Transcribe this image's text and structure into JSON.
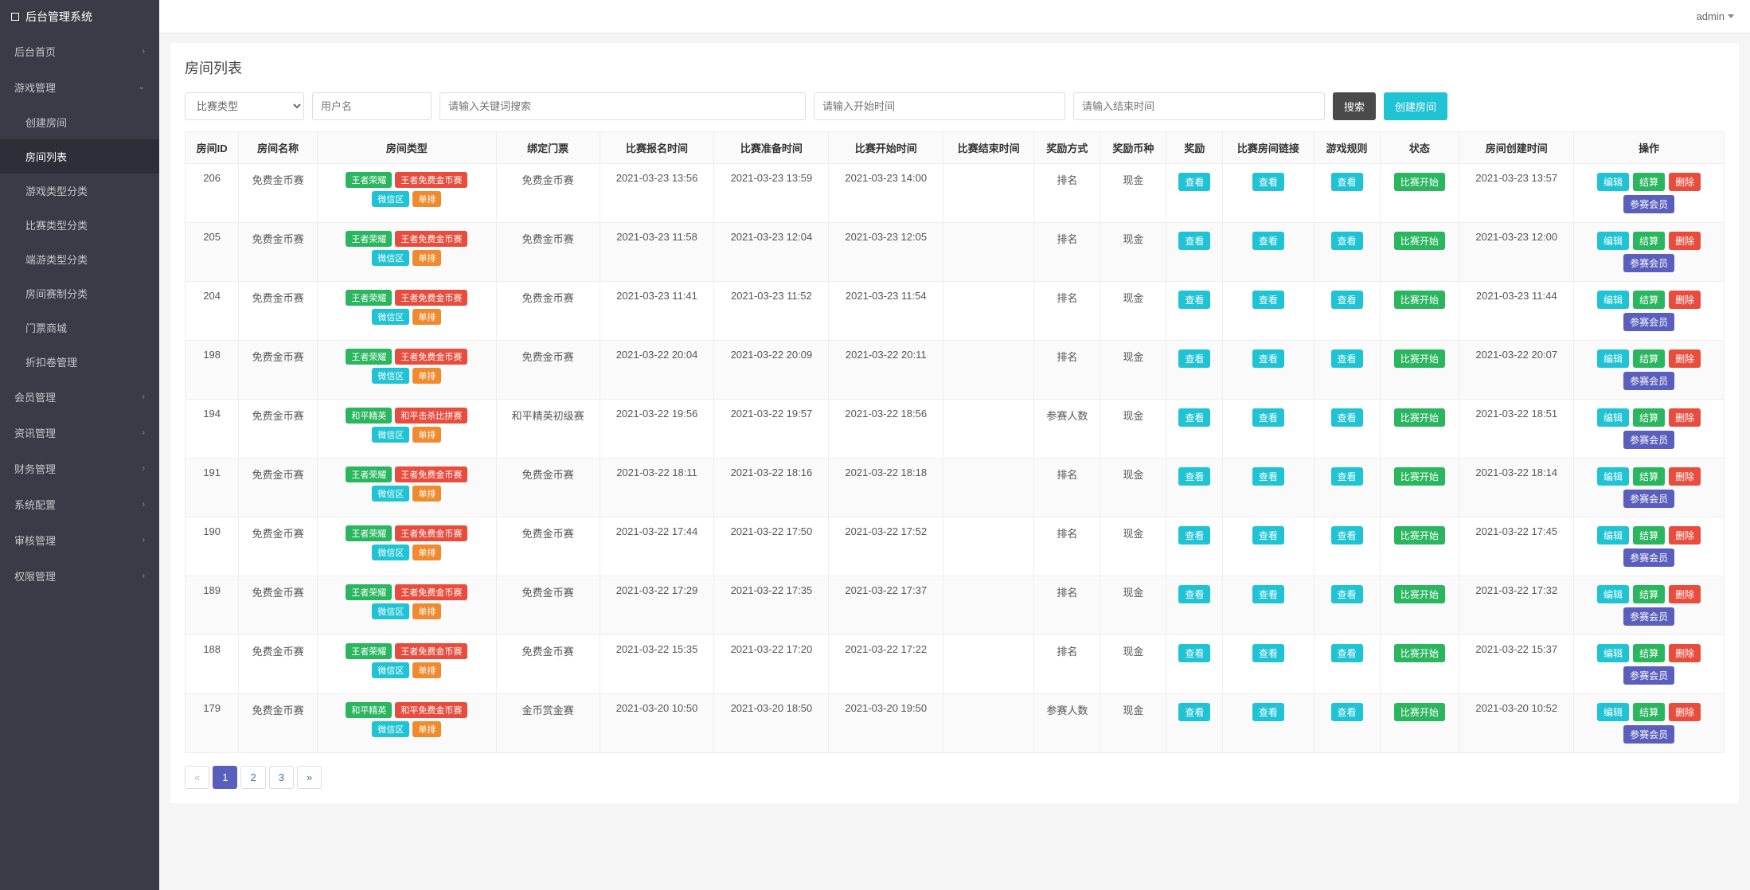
{
  "brand": "后台管理系统",
  "user": {
    "name": "admin"
  },
  "sidebar": {
    "items": [
      {
        "label": "后台首页",
        "kind": "parent"
      },
      {
        "label": "游戏管理",
        "kind": "parent-open"
      },
      {
        "label": "创建房间",
        "kind": "sub"
      },
      {
        "label": "房间列表",
        "kind": "sub-active"
      },
      {
        "label": "游戏类型分类",
        "kind": "sub"
      },
      {
        "label": "比赛类型分类",
        "kind": "sub"
      },
      {
        "label": "端游类型分类",
        "kind": "sub"
      },
      {
        "label": "房间赛制分类",
        "kind": "sub"
      },
      {
        "label": "门票商城",
        "kind": "sub"
      },
      {
        "label": "折扣卷管理",
        "kind": "sub"
      },
      {
        "label": "会员管理",
        "kind": "parent"
      },
      {
        "label": "资讯管理",
        "kind": "parent"
      },
      {
        "label": "财务管理",
        "kind": "parent"
      },
      {
        "label": "系统配置",
        "kind": "parent"
      },
      {
        "label": "审核管理",
        "kind": "parent"
      },
      {
        "label": "权限管理",
        "kind": "parent"
      }
    ]
  },
  "page": {
    "title": "房间列表",
    "filters": {
      "type_placeholder": "比赛类型",
      "user_placeholder": "用户名",
      "kw_placeholder": "请输入关键词搜索",
      "start_placeholder": "请输入开始时间",
      "end_placeholder": "请输入结束时间",
      "search_label": "搜索",
      "create_label": "创建房间"
    },
    "columns": [
      "房间ID",
      "房间名称",
      "房间类型",
      "绑定门票",
      "比赛报名时间",
      "比赛准备时间",
      "比赛开始时间",
      "比赛结束时间",
      "奖励方式",
      "奖励币种",
      "奖励",
      "比赛房间链接",
      "游戏规则",
      "状态",
      "房间创建时间",
      "操作"
    ],
    "pagination": {
      "prev": "«",
      "pages": [
        "1",
        "2",
        "3"
      ],
      "next": "»",
      "current": 1
    }
  },
  "tagColors": {
    "王者荣耀": "c-green",
    "王者免费金币赛": "c-red",
    "微信区": "c-teal",
    "单排": "c-orange",
    "和平精英": "c-green",
    "和平击杀比拼赛": "c-red",
    "和平免费金币赛": "c-red"
  },
  "labels": {
    "view": "查看",
    "status_started": "比赛开始",
    "op_edit": "编辑",
    "op_settle": "结算",
    "op_delete": "删除",
    "op_members": "参赛会员"
  },
  "rows": [
    {
      "id": "206",
      "name": "免费金币赛",
      "types": [
        "王者荣耀",
        "王者免费金币赛",
        "微信区",
        "单排"
      ],
      "ticket": "免费金币赛",
      "signup": "2021-03-23 13:56",
      "prepare": "2021-03-23 13:59",
      "start": "2021-03-23 14:00",
      "end": "",
      "rewardMode": "排名",
      "currency": "现金",
      "created": "2021-03-23 13:57"
    },
    {
      "id": "205",
      "name": "免费金币赛",
      "types": [
        "王者荣耀",
        "王者免费金币赛",
        "微信区",
        "单排"
      ],
      "ticket": "免费金币赛",
      "signup": "2021-03-23 11:58",
      "prepare": "2021-03-23 12:04",
      "start": "2021-03-23 12:05",
      "end": "",
      "rewardMode": "排名",
      "currency": "现金",
      "created": "2021-03-23 12:00"
    },
    {
      "id": "204",
      "name": "免费金币赛",
      "types": [
        "王者荣耀",
        "王者免费金币赛",
        "微信区",
        "单排"
      ],
      "ticket": "免费金币赛",
      "signup": "2021-03-23 11:41",
      "prepare": "2021-03-23 11:52",
      "start": "2021-03-23 11:54",
      "end": "",
      "rewardMode": "排名",
      "currency": "现金",
      "created": "2021-03-23 11:44"
    },
    {
      "id": "198",
      "name": "免费金币赛",
      "types": [
        "王者荣耀",
        "王者免费金币赛",
        "微信区",
        "单排"
      ],
      "ticket": "免费金币赛",
      "signup": "2021-03-22 20:04",
      "prepare": "2021-03-22 20:09",
      "start": "2021-03-22 20:11",
      "end": "",
      "rewardMode": "排名",
      "currency": "现金",
      "created": "2021-03-22 20:07"
    },
    {
      "id": "194",
      "name": "免费金币赛",
      "types": [
        "和平精英",
        "和平击杀比拼赛",
        "微信区",
        "单排"
      ],
      "ticket": "和平精英初级赛",
      "signup": "2021-03-22 19:56",
      "prepare": "2021-03-22 19:57",
      "start": "2021-03-22 18:56",
      "end": "",
      "rewardMode": "参赛人数",
      "currency": "现金",
      "created": "2021-03-22 18:51"
    },
    {
      "id": "191",
      "name": "免费金币赛",
      "types": [
        "王者荣耀",
        "王者免费金币赛",
        "微信区",
        "单排"
      ],
      "ticket": "免费金币赛",
      "signup": "2021-03-22 18:11",
      "prepare": "2021-03-22 18:16",
      "start": "2021-03-22 18:18",
      "end": "",
      "rewardMode": "排名",
      "currency": "现金",
      "created": "2021-03-22 18:14"
    },
    {
      "id": "190",
      "name": "免费金币赛",
      "types": [
        "王者荣耀",
        "王者免费金币赛",
        "微信区",
        "单排"
      ],
      "ticket": "免费金币赛",
      "signup": "2021-03-22 17:44",
      "prepare": "2021-03-22 17:50",
      "start": "2021-03-22 17:52",
      "end": "",
      "rewardMode": "排名",
      "currency": "现金",
      "created": "2021-03-22 17:45"
    },
    {
      "id": "189",
      "name": "免费金币赛",
      "types": [
        "王者荣耀",
        "王者免费金币赛",
        "微信区",
        "单排"
      ],
      "ticket": "免费金币赛",
      "signup": "2021-03-22 17:29",
      "prepare": "2021-03-22 17:35",
      "start": "2021-03-22 17:37",
      "end": "",
      "rewardMode": "排名",
      "currency": "现金",
      "created": "2021-03-22 17:32"
    },
    {
      "id": "188",
      "name": "免费金币赛",
      "types": [
        "王者荣耀",
        "王者免费金币赛",
        "微信区",
        "单排"
      ],
      "ticket": "免费金币赛",
      "signup": "2021-03-22 15:35",
      "prepare": "2021-03-22 17:20",
      "start": "2021-03-22 17:22",
      "end": "",
      "rewardMode": "排名",
      "currency": "现金",
      "created": "2021-03-22 15:37"
    },
    {
      "id": "179",
      "name": "免费金币赛",
      "types": [
        "和平精英",
        "和平免费金币赛",
        "微信区",
        "单排"
      ],
      "ticket": "金币赏金赛",
      "signup": "2021-03-20 10:50",
      "prepare": "2021-03-20 18:50",
      "start": "2021-03-20 19:50",
      "end": "",
      "rewardMode": "参赛人数",
      "currency": "现金",
      "created": "2021-03-20 10:52"
    }
  ]
}
